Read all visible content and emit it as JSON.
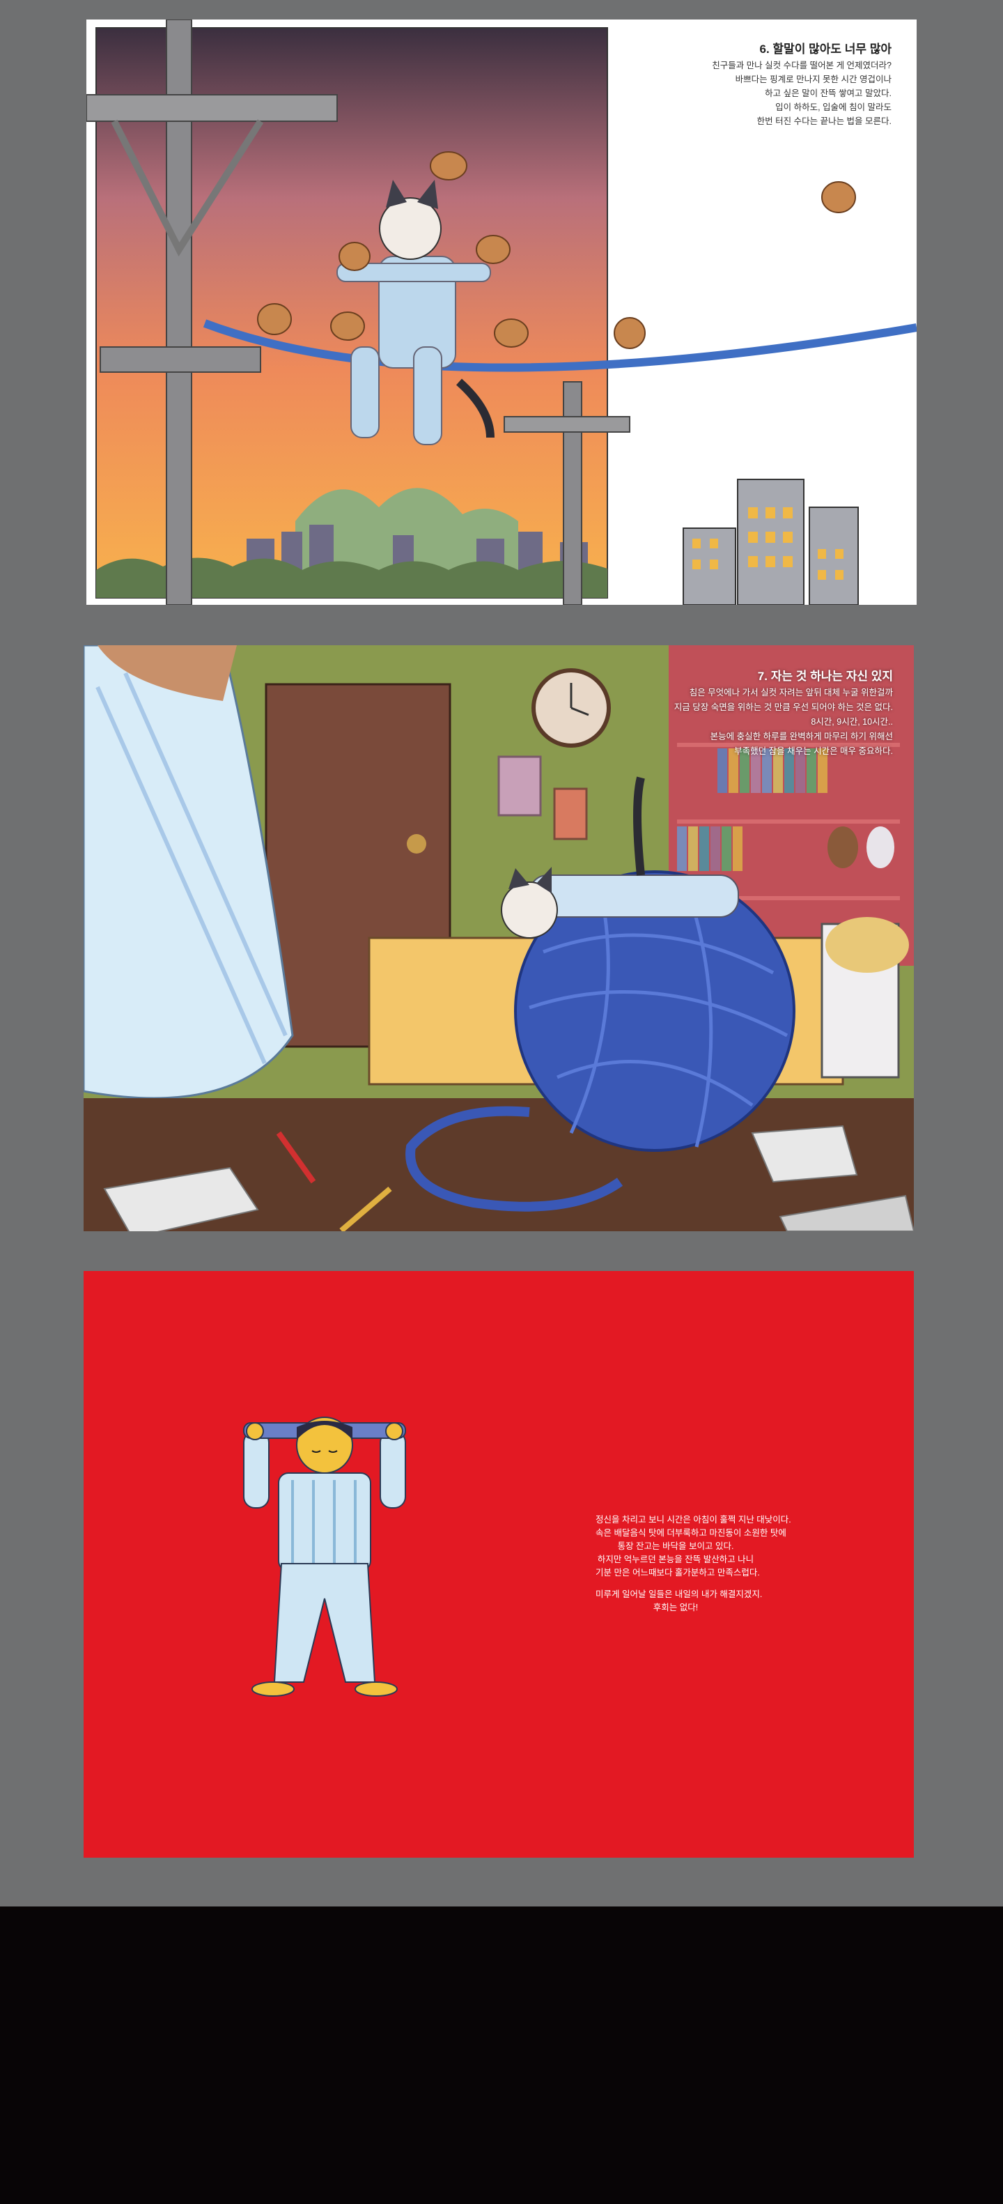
{
  "pages": [
    {
      "title": "6. 할말이 많아도 너무 많아",
      "lines": [
        "친구들과 만나 실컷 수다를 떨어본 게 언제였더라?",
        "바쁘다는 핑계로 만나지 못한 시간 영겁이나",
        "하고 싶은 말이 잔뜩 쌓여고 말았다.",
        "입이 하하도, 입술에 침이 말라도",
        "한번 터진 수다는 끝나는 법을 모른다."
      ]
    },
    {
      "title": "7. 자는 것 하나는 자신 있지",
      "lines": [
        "침은 무엇에나 가서 실컷 자려는 앞뒤 대체 누굴 위한걸까",
        "지금 당장 숙면을 위하는 것 만큼 우선 되어야 하는 것은 없다.",
        "8시간, 9시간, 10시간..",
        "본능에 충실한 하루를 완벽하게 마무리 하기 위해선",
        "부족했던 잠을 채우는 시간은 매우 중요하다."
      ]
    },
    {
      "paragraph1": [
        "정신을 차리고 보니 시간은 아침이 훌쩍 지난 대낮이다.",
        "속은 배달음식 탓에 더부룩하고 마진동이 소원한 탓에",
        "통장 잔고는 바닥을 보이고 있다.",
        "하지만 억누르던 본능을 잔뜩 발산하고 나니",
        "기분 만은 어느때보다 홀가분하고 만족스럽다."
      ],
      "paragraph2": [
        "미루게 일어날 일들은 내일의 내가 해결지겠지.",
        "후회는 없다!"
      ]
    }
  ],
  "colors": {
    "background": "#6f7071",
    "page3_red": "#e31923",
    "footer": "#080506"
  }
}
